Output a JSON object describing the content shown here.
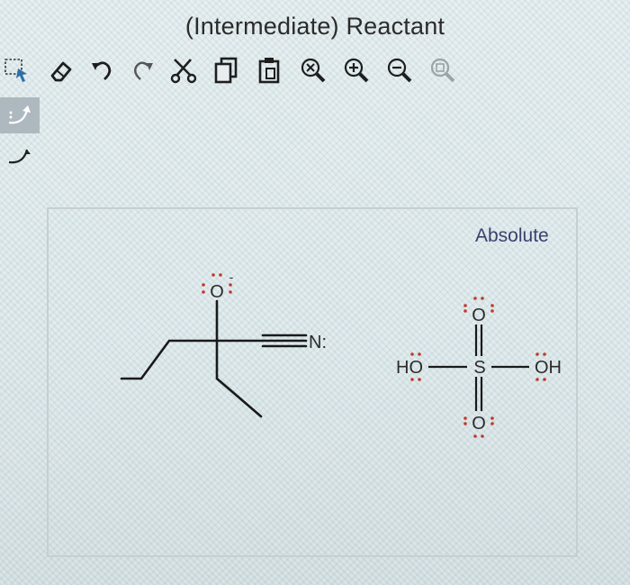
{
  "window": {
    "title": "(Intermediate) Reactant"
  },
  "toolbar": {
    "items": [
      {
        "name": "select-icon",
        "label": "Select"
      },
      {
        "name": "eraser-icon",
        "label": "Erase"
      },
      {
        "name": "undo-icon",
        "label": "Undo"
      },
      {
        "name": "redo-icon",
        "label": "Redo"
      },
      {
        "name": "cut-icon",
        "label": "Cut"
      },
      {
        "name": "copy-icon",
        "label": "Copy"
      },
      {
        "name": "paste-icon",
        "label": "Paste"
      },
      {
        "name": "zoom-reset-icon",
        "label": "Clear zoom"
      },
      {
        "name": "zoom-in-icon",
        "label": "Zoom in"
      },
      {
        "name": "zoom-out-icon",
        "label": "Zoom out"
      },
      {
        "name": "zoom-fit-icon",
        "label": "Fit"
      }
    ]
  },
  "left_tools": [
    {
      "name": "electron-pair-arrow-icon",
      "active": true
    },
    {
      "name": "single-electron-arrow-icon",
      "active": false
    }
  ],
  "canvas": {
    "stereo_label": "Absolute",
    "molecule1": {
      "oxygen": "O",
      "oxygen_charge": "-",
      "nitrogen": "N:"
    },
    "molecule2": {
      "left_group": "HO",
      "center": "S",
      "right_group": "OH",
      "top_oxygen": "O",
      "bottom_oxygen": "O"
    }
  },
  "colors": {
    "text": "#2b2b2b",
    "lone_pair_red": "#c0392b",
    "bond": "#1a1a1a",
    "stereo_label": "#3b3f6e"
  }
}
